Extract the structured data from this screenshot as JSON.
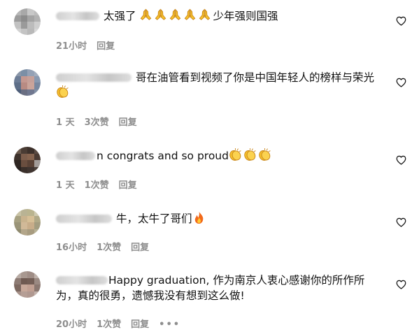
{
  "comments": [
    {
      "text": "太强了",
      "text_after": "少年强则国强",
      "time": "21小时",
      "likes": "",
      "reply": "回复"
    },
    {
      "text": "哥在油管看到视频了你是中国年轻人的榜样与荣光",
      "time": "1 天",
      "likes": "3次赞",
      "reply": "回复"
    },
    {
      "text": "n congrats and so proud",
      "time": "1 天",
      "likes": "1次赞",
      "reply": "回复"
    },
    {
      "text": "牛，太牛了哥们",
      "time": "16小时",
      "likes": "1次赞",
      "reply": "回复"
    },
    {
      "text": "Happy graduation, 作为南京人衷心感谢你的所作所为，真的很勇，遗憾我没有想到这么做!",
      "time": "20小时",
      "likes": "1次赞",
      "reply": "回复",
      "more": "•••"
    }
  ],
  "icons": {
    "like": "heart-outline-icon",
    "emoji_pray": "folded-hands-emoji",
    "emoji_clap": "clapping-hands-emoji",
    "emoji_fire": "fire-emoji"
  },
  "colors": {
    "text": "#111111",
    "meta": "#8e8e8e",
    "emoji_yellow": "#f7c22d",
    "fire": "#f26a1b"
  }
}
